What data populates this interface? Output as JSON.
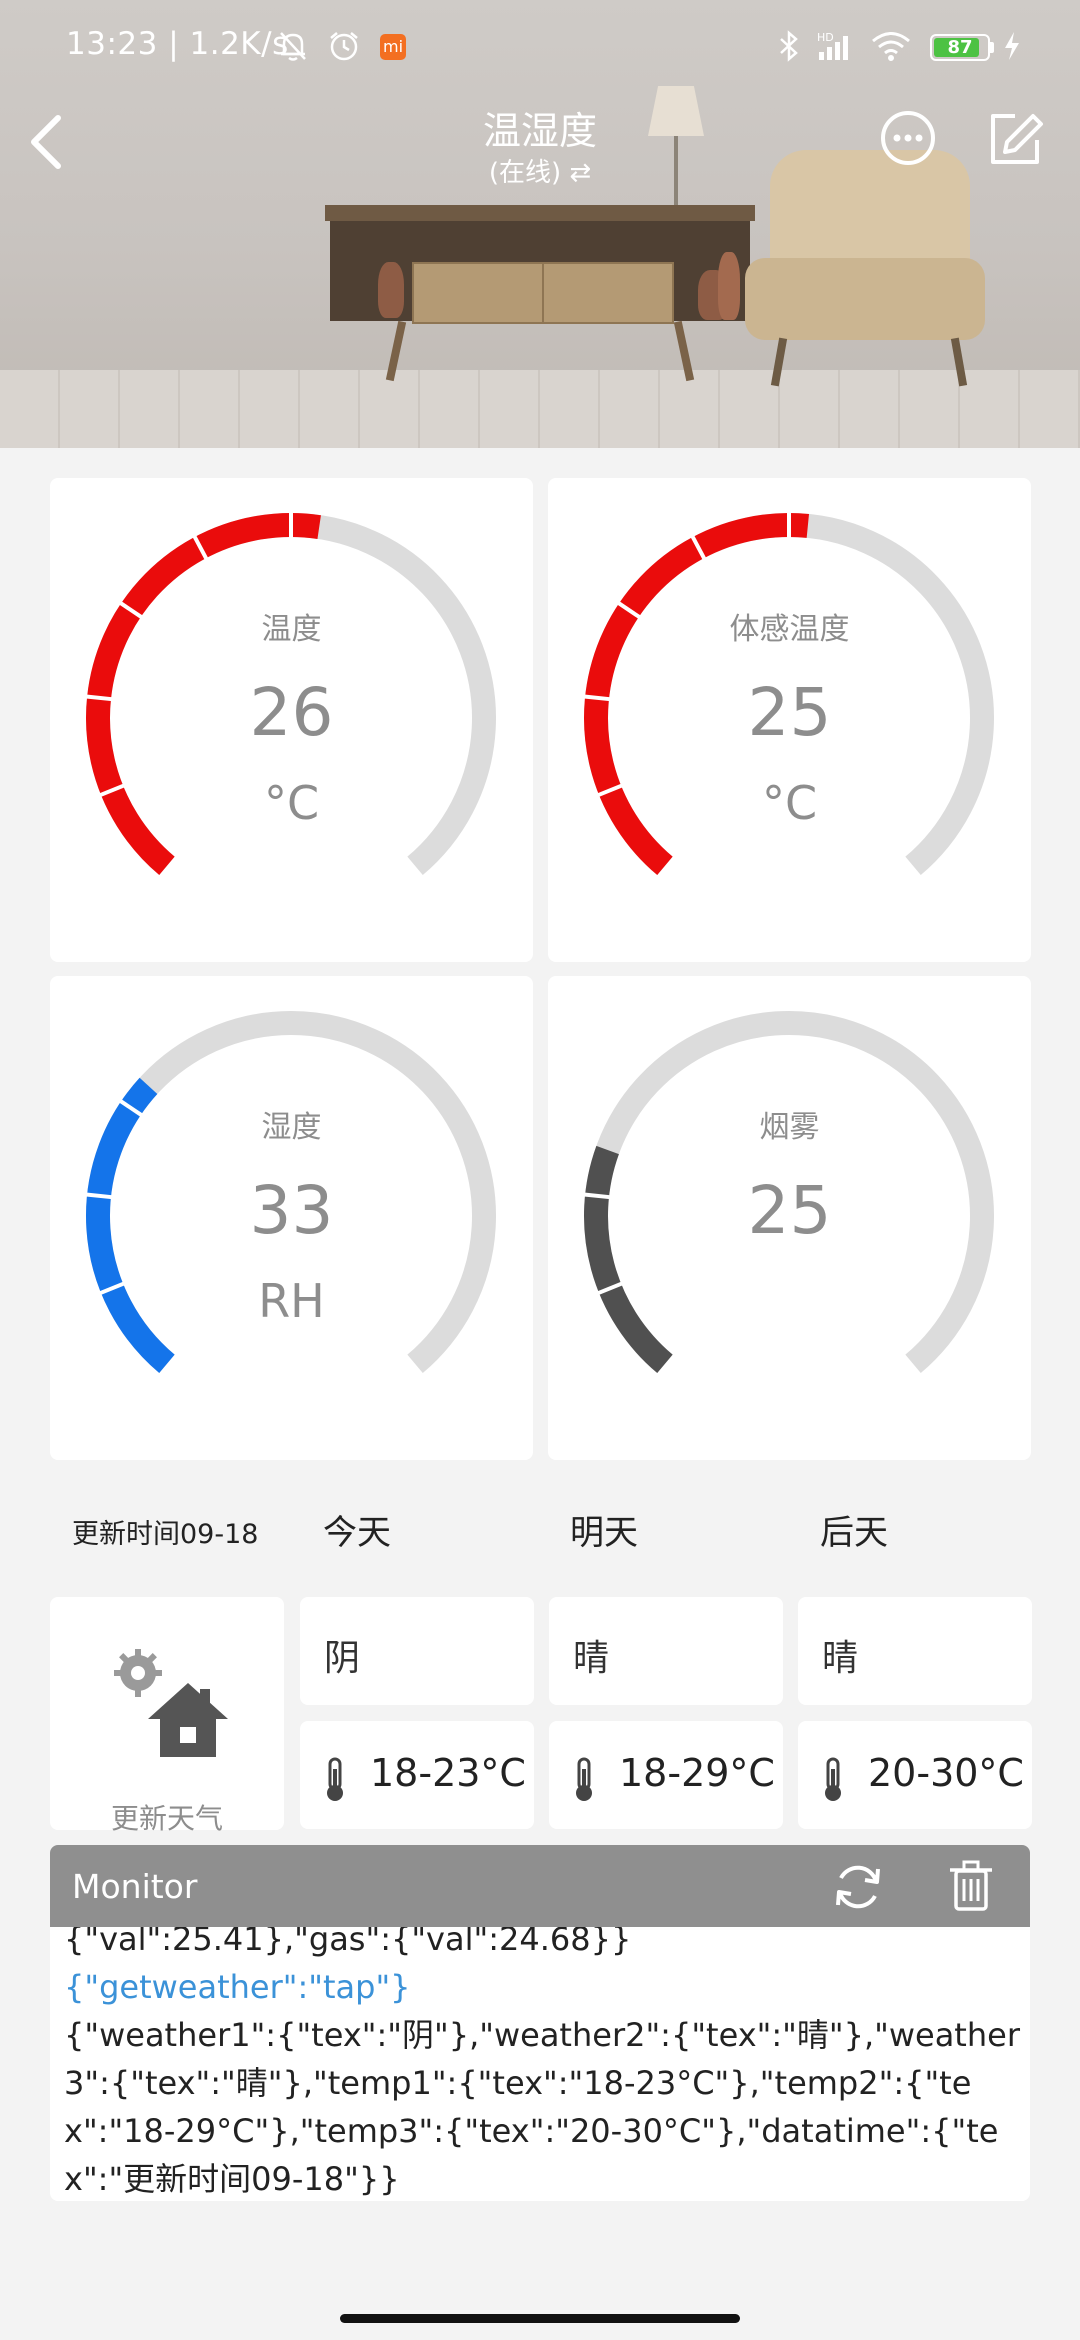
{
  "status_bar": {
    "time": "13:23 | 1.2K/s",
    "battery": "87",
    "battery_level": 0.87,
    "icons": [
      "bell-off-icon",
      "alarm-icon",
      "mi-app-icon",
      "bluetooth-icon",
      "hd-signal-icon",
      "wifi-icon",
      "battery-icon",
      "charging-icon"
    ]
  },
  "header": {
    "title": "温湿度",
    "subtitle": "(在线) ⇄",
    "icons": [
      "back-icon",
      "more-icon",
      "edit-icon"
    ]
  },
  "gauges": [
    {
      "label": "温度",
      "value": "26",
      "unit": "°C",
      "fraction": 0.53,
      "color": "#ea0c0c"
    },
    {
      "label": "体感温度",
      "value": "25",
      "unit": "°C",
      "fraction": 0.52,
      "color": "#ea0c0c"
    },
    {
      "label": "湿度",
      "value": "33",
      "unit": "RH",
      "fraction": 0.33,
      "color": "#1474ea"
    },
    {
      "label": "烟雾",
      "value": "25",
      "unit": "",
      "fraction": 0.25,
      "color": "#505050"
    }
  ],
  "weather": {
    "update_time": "更新时间09-18",
    "days": [
      "今天",
      "明天",
      "后天"
    ],
    "conditions": [
      "阴",
      "晴",
      "晴"
    ],
    "temps": [
      "18-23°C",
      "18-29°C",
      "20-30°C"
    ],
    "refresh_label": "更新天气"
  },
  "monitor": {
    "title": "Monitor",
    "lines": [
      {
        "text": "{\"val\":25.41},\"gas\":{\"val\":24.68}}",
        "color": "#222222"
      },
      {
        "text": "{\"getweather\":\"tap\"}",
        "color": "#3b92d8"
      },
      {
        "text": "{\"weather1\":{\"tex\":\"阴\"},\"weather2\":{\"tex\":\"晴\"},\"weather3\":{\"tex\":\"晴\"},\"temp1\":{\"tex\":\"18-23°C\"},\"temp2\":{\"tex\":\"18-29°C\"},\"temp3\":{\"tex\":\"20-30°C\"},\"datatime\":{\"tex\":\"更新时间09-18\"}}",
        "color": "#222222"
      }
    ]
  }
}
